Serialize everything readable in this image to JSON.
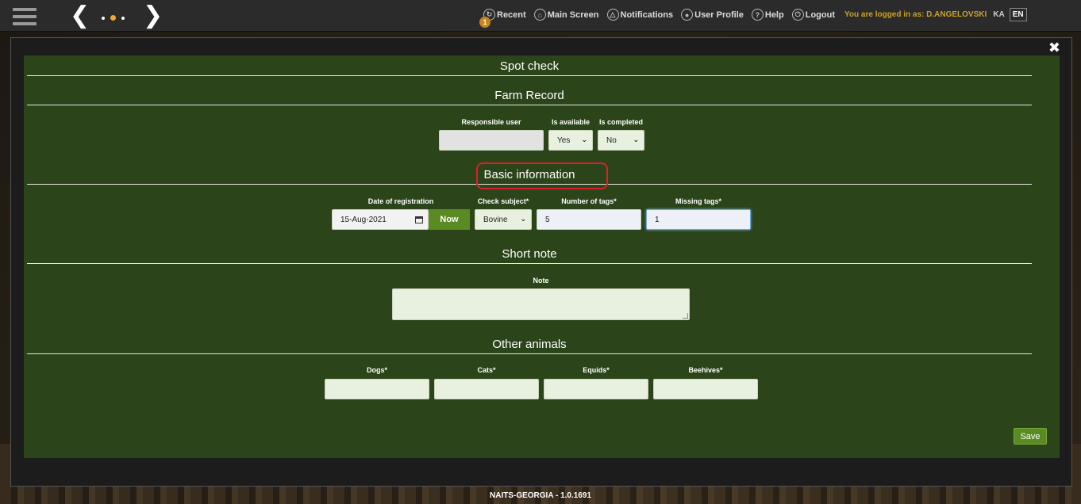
{
  "topbar": {
    "menu": {
      "recent": "Recent",
      "recent_badge": "1",
      "main_screen": "Main Screen",
      "notifications": "Notifications",
      "user_profile": "User Profile",
      "help": "Help",
      "logout": "Logout"
    },
    "logged_in": "You are logged in as: D.ANGELOVSKI",
    "languages": [
      "KA",
      "EN"
    ],
    "active_language": "EN",
    "accent_color": "#c9a227"
  },
  "modal": {
    "title": "Spot check",
    "farm_record": {
      "heading": "Farm Record",
      "responsible_user_label": "Responsible user",
      "responsible_user_value": "",
      "is_available_label": "Is available",
      "is_available_value": "Yes",
      "is_completed_label": "Is completed",
      "is_completed_value": "No"
    },
    "basic_info": {
      "heading": "Basic information",
      "date_label": "Date of registration",
      "date_value": "15-Aug-2021",
      "now_button": "Now",
      "check_subject_label": "Check subject*",
      "check_subject_value": "Bovine",
      "number_of_tags_label": "Number of tags*",
      "number_of_tags_value": "5",
      "missing_tags_label": "Missing tags*",
      "missing_tags_value": "1"
    },
    "short_note": {
      "heading": "Short note",
      "note_label": "Note",
      "note_value": ""
    },
    "other_animals": {
      "heading": "Other animals",
      "dogs_label": "Dogs*",
      "cats_label": "Cats*",
      "equids_label": "Equids*",
      "beehives_label": "Beehives*"
    },
    "save_button": "Save",
    "panel_color": "#2b4419",
    "highlight_color": "#d8222a"
  },
  "footer": "NAITS-GEORGIA - 1.0.1691"
}
